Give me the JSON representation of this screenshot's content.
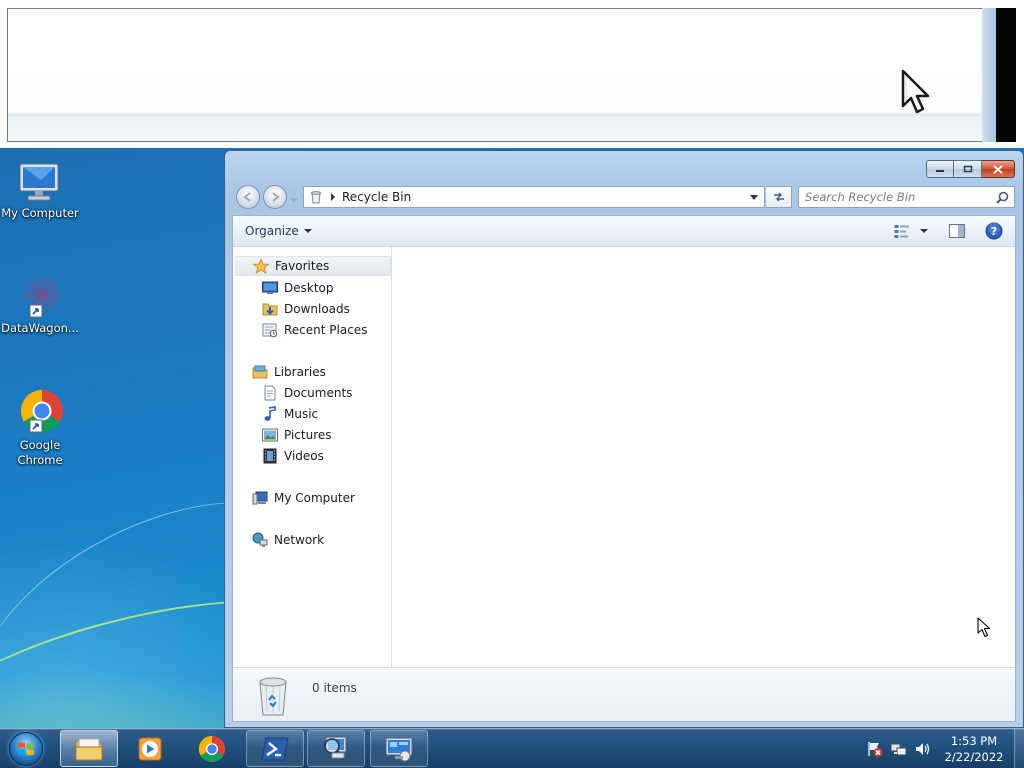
{
  "desktop": {
    "icons": [
      {
        "label": "My Computer",
        "icon": "computer-icon"
      },
      {
        "label": "DataWagon...",
        "icon": "datawagon-icon"
      },
      {
        "label": "Google Chrome",
        "icon": "chrome-icon"
      }
    ]
  },
  "explorer": {
    "address": {
      "crumb": "Recycle Bin"
    },
    "search": {
      "placeholder": "Search Recycle Bin"
    },
    "toolbar": {
      "organize_label": "Organize"
    },
    "nav": {
      "favorites": {
        "label": "Favorites",
        "items": [
          "Desktop",
          "Downloads",
          "Recent Places"
        ]
      },
      "libraries": {
        "label": "Libraries",
        "items": [
          "Documents",
          "Music",
          "Pictures",
          "Videos"
        ]
      },
      "computer": {
        "label": "My Computer"
      },
      "network": {
        "label": "Network"
      }
    },
    "details": {
      "count": "0 items"
    }
  },
  "taskbar": {
    "pinned": [
      "explorer-icon",
      "media-player-icon",
      "chrome-icon",
      "powershell-icon",
      "magnifier-icon",
      "remote-desktop-icon"
    ],
    "clock": {
      "time": "1:53 PM",
      "date": "2/22/2022"
    },
    "tray": [
      "action-center-flag-icon",
      "network-icon",
      "volume-icon"
    ]
  },
  "colors": {
    "desktop_blue": "#1a74b8",
    "window_frame": "#b7cfe8",
    "close_red": "#c33d1f",
    "taskbar": "#21517f"
  }
}
